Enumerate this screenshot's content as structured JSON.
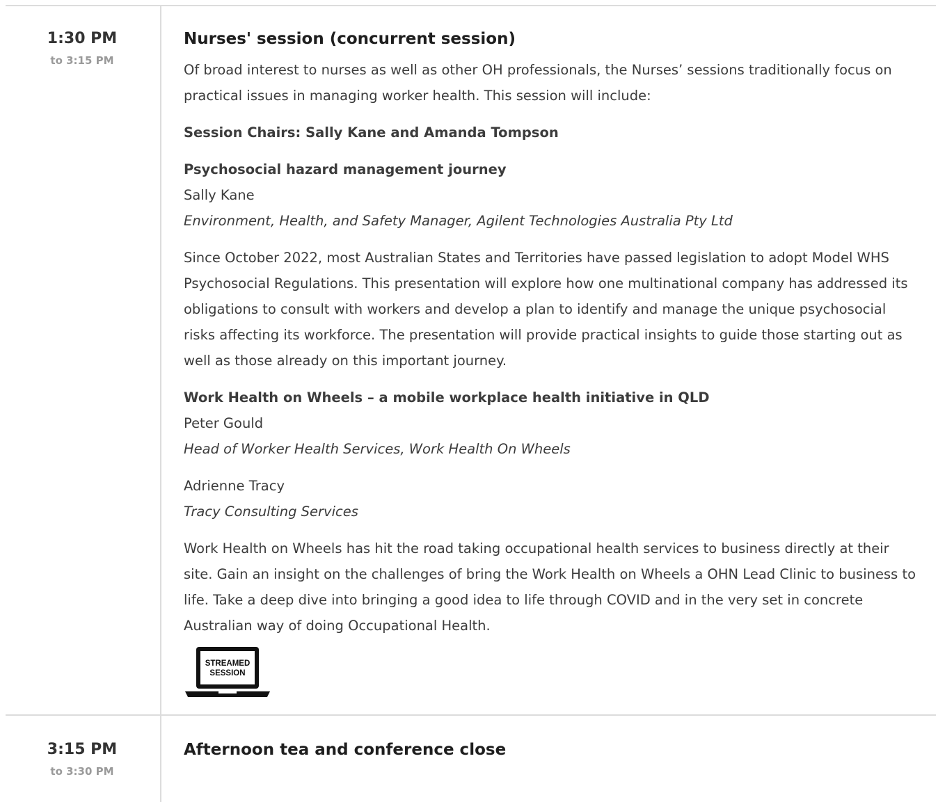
{
  "sessions": [
    {
      "start": "1:30 PM",
      "end": "to 3:15 PM",
      "title": "Nurses' session (concurrent session)",
      "intro": "Of broad interest to nurses as well as other OH professionals, the Nurses’ sessions traditionally focus on practical issues in managing worker health. This session will include:",
      "chairs": "Session Chairs: Sally Kane and  Amanda Tompson",
      "talks": [
        {
          "title": "Psychosocial hazard management journey",
          "speaker": "Sally Kane",
          "role": "Environment, Health, and Safety Manager, Agilent Technologies Australia Pty Ltd",
          "abstract": "Since October 2022, most Australian States and Territories have passed legislation to adopt Model WHS Psychosocial Regulations. This presentation will explore how one multinational company has addressed its obligations to consult with workers and develop a plan to identify and manage the unique psychosocial risks affecting its workforce. The presentation will provide practical insights to guide those starting out as well as those already on this important journey."
        },
        {
          "title": "Work Health on Wheels – a mobile workplace health initiative in QLD",
          "speaker": "Peter Gould",
          "role": "Head of Worker Health Services, Work Health On Wheels",
          "speaker2": "Adrienne Tracy",
          "role2": "Tracy Consulting Services",
          "abstract": "Work Health on Wheels has hit the road taking occupational health services to business directly at their site. Gain an insight on the challenges of bring the Work Health on Wheels a OHN Lead Clinic to business to life. Take a deep dive into bringing a good idea to life through COVID and in the very set in concrete Australian way of doing Occupational Health."
        }
      ],
      "badge": {
        "line1": "STREAMED",
        "line2": "SESSION",
        "icon": "laptop-icon"
      }
    },
    {
      "start": "3:15 PM",
      "end": "to 3:30 PM",
      "title": "Afternoon tea and conference close"
    }
  ],
  "colors": {
    "divider": "#dcdcdc",
    "text": "#3c3c3c",
    "muted": "#9a9a9a",
    "heading": "#1e1e1e"
  }
}
